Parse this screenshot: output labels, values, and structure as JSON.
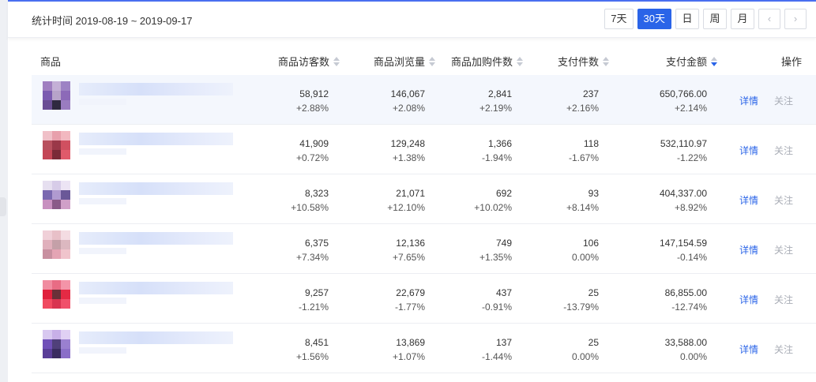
{
  "header": {
    "stat_time_label": "统计时间 2019-08-19 ~ 2019-09-17",
    "periods": [
      "7天",
      "30天",
      "日",
      "周",
      "月"
    ],
    "active_period": "30天",
    "prev_icon": "chevron-left-icon",
    "next_icon": "chevron-right-icon"
  },
  "table": {
    "columns": [
      "商品",
      "商品访客数",
      "商品浏览量",
      "商品加购件数",
      "支付件数",
      "支付金额",
      "操作"
    ],
    "sorted_column": "支付金额",
    "sort_direction": "desc",
    "detail_label": "详情",
    "follow_label": "关注",
    "rows": [
      {
        "visitors": "58,912",
        "visitors_change": "+2.88%",
        "views": "146,067",
        "views_change": "+2.08%",
        "cart": "2,841",
        "cart_change": "+2.19%",
        "paid_items": "237",
        "paid_items_change": "+2.16%",
        "paid_amount": "650,766.00",
        "paid_amount_change": "+2.14%",
        "thumb_colors": [
          "#a07fc0",
          "#c4b0d6",
          "#9d83c4",
          "#7b5bb0",
          "#b7a3c9",
          "#8c6ab8",
          "#6a4e94",
          "#2f2a40",
          "#9a7cc0"
        ]
      },
      {
        "visitors": "41,909",
        "visitors_change": "+0.72%",
        "views": "129,248",
        "views_change": "+1.38%",
        "cart": "1,366",
        "cart_change": "-1.94%",
        "paid_items": "118",
        "paid_items_change": "-1.67%",
        "paid_amount": "532,110.97",
        "paid_amount_change": "-1.22%",
        "thumb_colors": [
          "#f0c0c8",
          "#e8a0ac",
          "#f2b8c0",
          "#b8505e",
          "#9a3848",
          "#d05060",
          "#c44656",
          "#7a2a38",
          "#e05a6a"
        ]
      },
      {
        "visitors": "8,323",
        "visitors_change": "+10.58%",
        "views": "21,071",
        "views_change": "+12.10%",
        "cart": "692",
        "cart_change": "+10.02%",
        "paid_items": "93",
        "paid_items_change": "+8.14%",
        "paid_amount": "404,337.00",
        "paid_amount_change": "+8.92%",
        "thumb_colors": [
          "#e6dff0",
          "#d7cce8",
          "#ece4f4",
          "#7a68b0",
          "#b09ad0",
          "#6a5898",
          "#c890c0",
          "#8a5a88",
          "#d0a0c8"
        ]
      },
      {
        "visitors": "6,375",
        "visitors_change": "+7.34%",
        "views": "12,136",
        "views_change": "+7.65%",
        "cart": "749",
        "cart_change": "+1.35%",
        "paid_items": "106",
        "paid_items_change": "0.00%",
        "paid_amount": "147,154.59",
        "paid_amount_change": "-0.14%",
        "thumb_colors": [
          "#f0d0d8",
          "#e8c0c8",
          "#f4dce2",
          "#e0b0bc",
          "#c4a0a8",
          "#dcb8c0",
          "#c890a0",
          "#e4a4b4",
          "#f0c4cc"
        ]
      },
      {
        "visitors": "9,257",
        "visitors_change": "-1.21%",
        "views": "22,679",
        "views_change": "-1.77%",
        "cart": "437",
        "cart_change": "-0.91%",
        "paid_items": "25",
        "paid_items_change": "-13.79%",
        "paid_amount": "86,855.00",
        "paid_amount_change": "-12.74%",
        "thumb_colors": [
          "#f08ca0",
          "#e86c84",
          "#f494a8",
          "#e0203c",
          "#6a3038",
          "#e42a44",
          "#f04a60",
          "#d83450",
          "#f0506a"
        ]
      },
      {
        "visitors": "8,451",
        "visitors_change": "+1.56%",
        "views": "13,869",
        "views_change": "+1.07%",
        "cart": "137",
        "cart_change": "-1.44%",
        "paid_items": "25",
        "paid_items_change": "0.00%",
        "paid_amount": "33,588.00",
        "paid_amount_change": "0.00%",
        "thumb_colors": [
          "#d8c8f0",
          "#c8b0e8",
          "#e0d0f4",
          "#7050b8",
          "#50407a",
          "#9a80d0",
          "#5a3e98",
          "#3a2c60",
          "#8a6ec8"
        ]
      }
    ]
  }
}
